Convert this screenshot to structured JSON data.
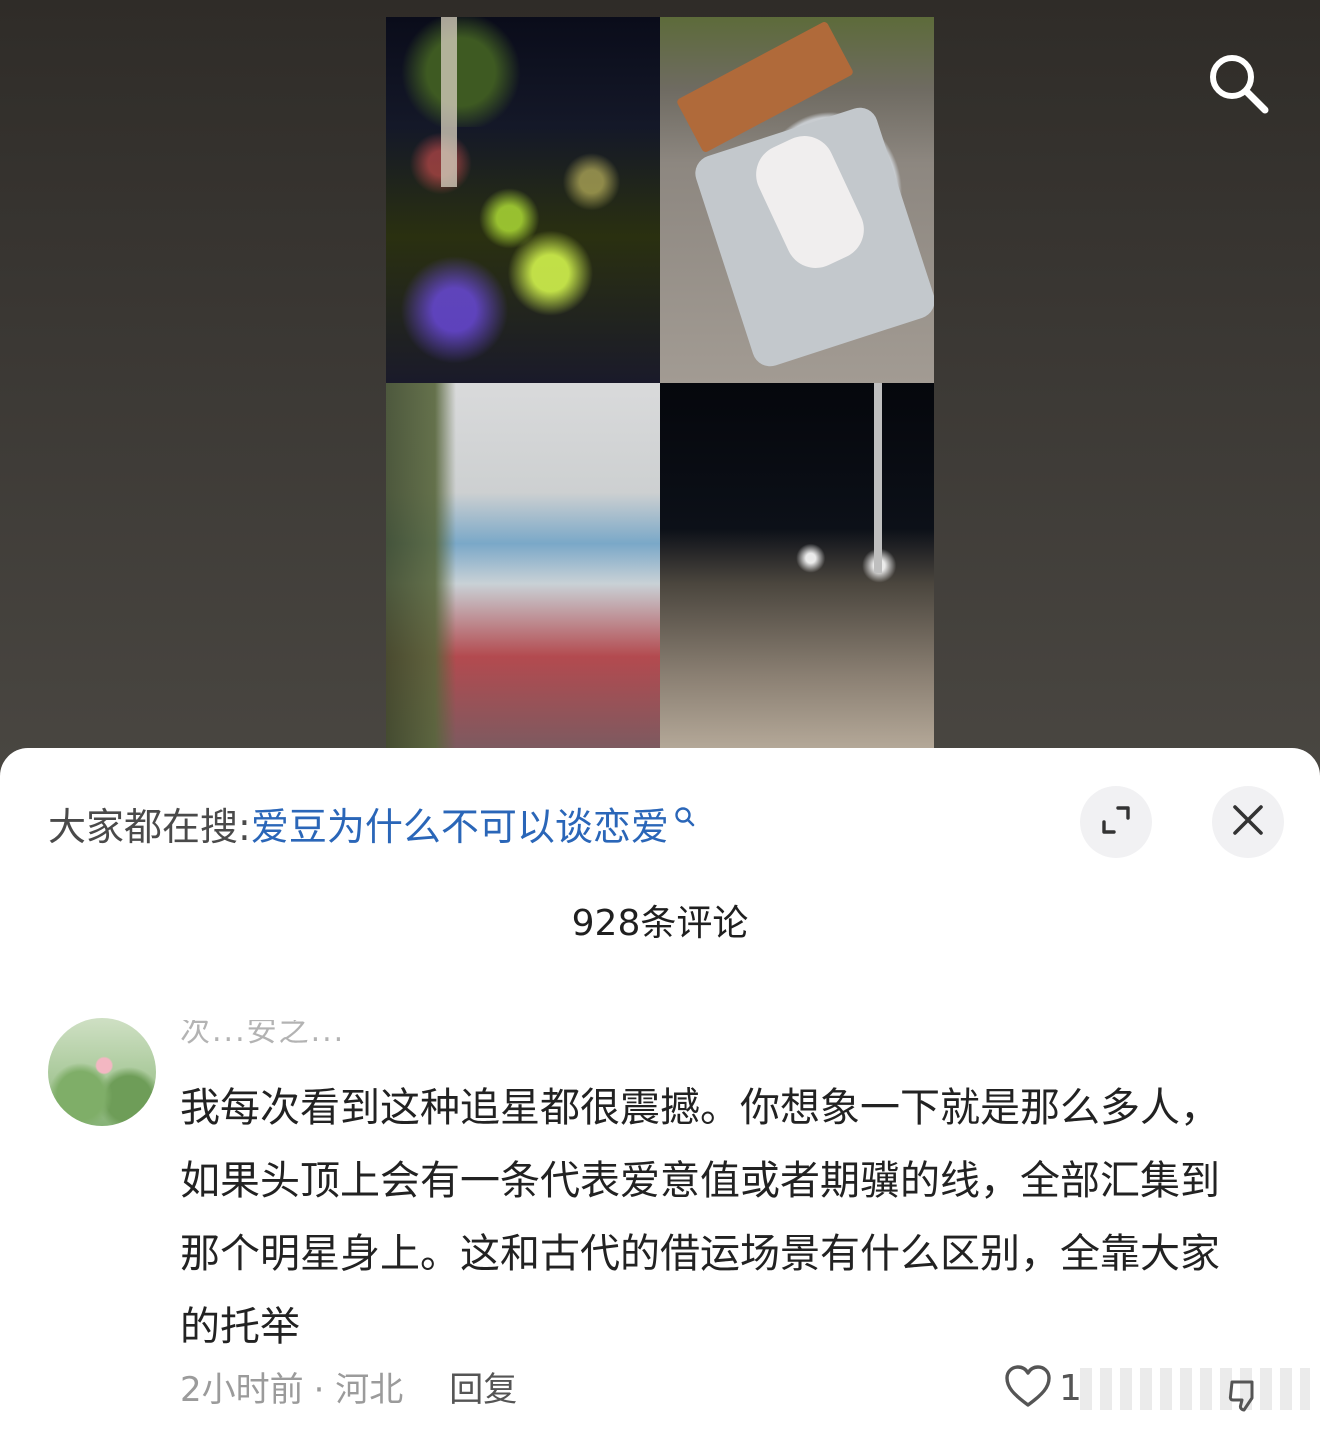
{
  "hot_search": {
    "label": "大家都在搜:",
    "query": "爱豆为什么不可以谈恋爱"
  },
  "icons": {
    "search": "search-icon",
    "query_search": "small-search-icon",
    "expand": "expand-icon",
    "close": "close-icon",
    "like": "heart-icon",
    "dislike": "thumb-down-icon"
  },
  "comments_header": {
    "count_label": "928条评论"
  },
  "comment": {
    "username": "次...安之...",
    "text": "我每次看到这种追星都很震撼。你想象一下就是那么多人，如果头顶上会有一条代表爱意值或者期骥的线，全部汇集到那个明星身上。这和古代的借运场景有什么区别，全靠大家的托举",
    "time": "2小时前",
    "location": "· 河北",
    "reply_label": "回复",
    "like_count": "1"
  },
  "colors": {
    "link": "#2a66b8",
    "sheet_bg": "#ffffff",
    "button_bg": "#f1f1f3"
  }
}
